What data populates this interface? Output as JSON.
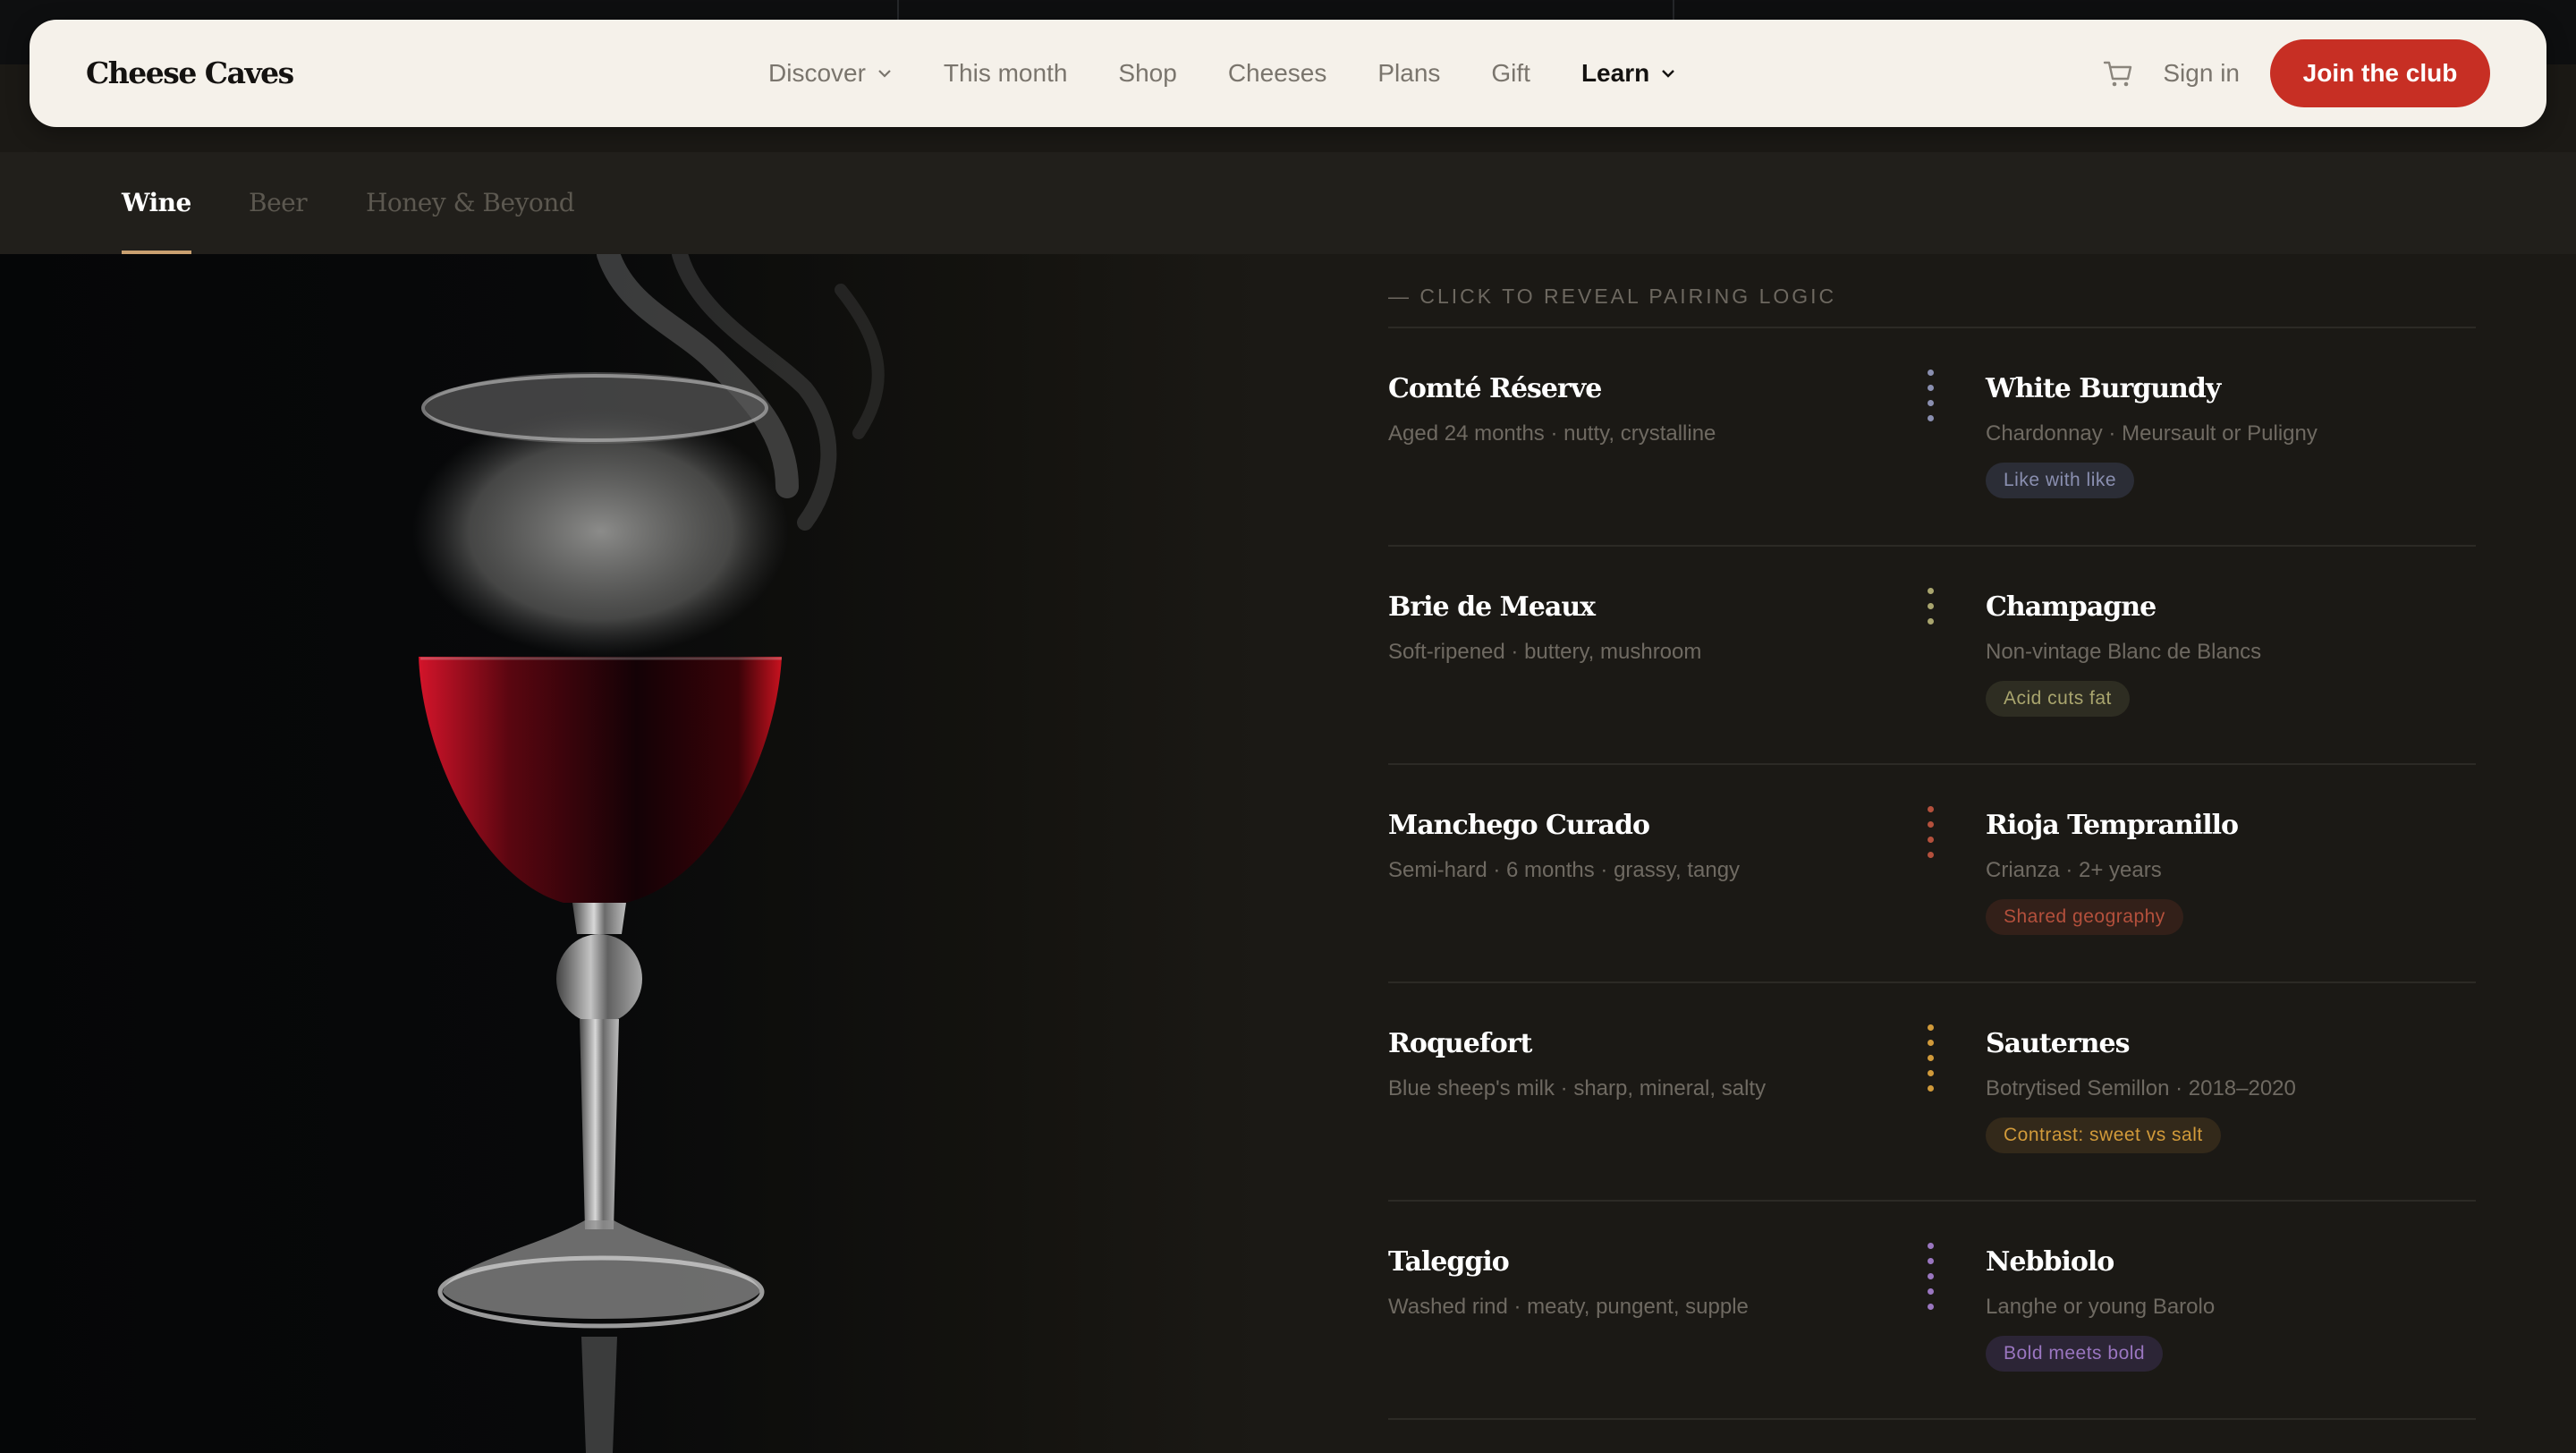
{
  "brand": "Cheese Caves",
  "nav": {
    "links": [
      "Discover",
      "This month",
      "Shop",
      "Cheeses",
      "Plans",
      "Gift",
      "Learn"
    ],
    "active": "Learn",
    "sign_in": "Sign in",
    "cta": "Join the club"
  },
  "tabs": [
    {
      "label": "Wine",
      "active": true
    },
    {
      "label": "Beer",
      "active": false
    },
    {
      "label": "Honey & Beyond",
      "active": false
    }
  ],
  "pairings": {
    "section_label": "— CLICK TO REVEAL PAIRING LOGIC",
    "rows": [
      {
        "cheese": "Comté Réserve",
        "cheese_desc": "Aged 24 months · nutty, crystalline",
        "drink": "White Burgundy",
        "drink_desc": "Chardonnay · Meursault or Puligny",
        "tag": "Like with like",
        "color": "#8a8fb0",
        "tag_bg": "#2b2d36",
        "dots": 4
      },
      {
        "cheese": "Brie de Meaux",
        "cheese_desc": "Soft-ripened · buttery, mushroom",
        "drink": "Champagne",
        "drink_desc": "Non-vintage Blanc de Blancs",
        "tag": "Acid cuts fat",
        "color": "#a9a56e",
        "tag_bg": "#2e2d22",
        "dots": 3
      },
      {
        "cheese": "Manchego Curado",
        "cheese_desc": "Semi-hard · 6 months · grassy, tangy",
        "drink": "Rioja Tempranillo",
        "drink_desc": "Crianza · 2+ years",
        "tag": "Shared geography",
        "color": "#b4503c",
        "tag_bg": "#332019",
        "dots": 4
      },
      {
        "cheese": "Roquefort",
        "cheese_desc": "Blue sheep's milk · sharp, mineral, salty",
        "drink": "Sauternes",
        "drink_desc": "Botrytised Semillon · 2018–2020",
        "tag": "Contrast: sweet vs salt",
        "color": "#d19a3a",
        "tag_bg": "#33291a",
        "dots": 5
      },
      {
        "cheese": "Taleggio",
        "cheese_desc": "Washed rind · meaty, pungent, supple",
        "drink": "Nebbiolo",
        "drink_desc": "Langhe or young Barolo",
        "tag": "Bold meets bold",
        "color": "#9a76c0",
        "tag_bg": "#2c2536",
        "dots": 5
      }
    ]
  },
  "icons": {
    "cart": "cart-icon",
    "chevron": "chevron-down-icon"
  },
  "colors": {
    "accent": "#c72f24",
    "nav_bg": "#f5f1ea",
    "page_bg": "#1b1915",
    "tab_underline": "#c9a070"
  }
}
